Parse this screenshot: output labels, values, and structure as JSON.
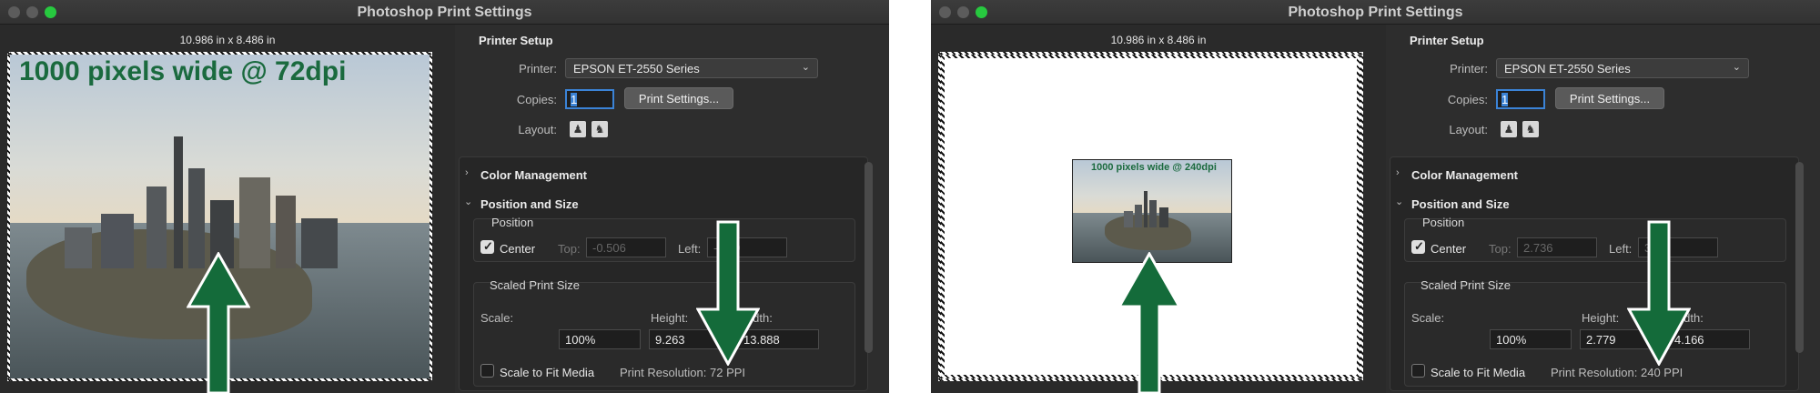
{
  "window_title": "Photoshop Print Settings",
  "colors": {
    "arrow": "#146b3a",
    "accent": "#3b83d6",
    "caption": "#1a6a3e"
  },
  "left": {
    "preview_dims": "10.986 in x 8.486 in",
    "photo_caption": "1000 pixels wide @ 72dpi",
    "printer_setup": "Printer Setup",
    "printer_label": "Printer:",
    "printer_value": "EPSON ET-2550 Series",
    "copies_label": "Copies:",
    "copies_value": "1",
    "print_settings_button": "Print Settings...",
    "layout_label": "Layout:",
    "color_management": "Color Management",
    "position_and_size": "Position and Size",
    "position": "Position",
    "center_label": "Center",
    "top_label": "Top:",
    "top_value": "-0.506",
    "left_label": "Left:",
    "left_value": "-1.39",
    "scaled_print_size": "Scaled Print Size",
    "scale_label": "Scale:",
    "height_label": "Height:",
    "width_label": "Width:",
    "scale_value": "100%",
    "height_value": "9.263",
    "width_value": "13.888",
    "scale_to_fit": "Scale to Fit Media",
    "print_resolution": "Print Resolution: 72 PPI"
  },
  "right": {
    "preview_dims": "10.986 in x 8.486 in",
    "photo_caption": "1000 pixels wide @ 240dpi",
    "printer_setup": "Printer Setup",
    "printer_label": "Printer:",
    "printer_value": "EPSON ET-2550 Series",
    "copies_label": "Copies:",
    "copies_value": "1",
    "print_settings_button": "Print Settings...",
    "layout_label": "Layout:",
    "color_management": "Color Management",
    "position_and_size": "Position and Size",
    "position": "Position",
    "center_label": "Center",
    "top_label": "Top:",
    "top_value": "2.736",
    "left_label": "Left:",
    "left_value": "3.41",
    "scaled_print_size": "Scaled Print Size",
    "scale_label": "Scale:",
    "height_label": "Height:",
    "width_label": "Width:",
    "scale_value": "100%",
    "height_value": "2.779",
    "width_value": "4.166",
    "scale_to_fit": "Scale to Fit Media",
    "print_resolution": "Print Resolution: 240 PPI"
  }
}
